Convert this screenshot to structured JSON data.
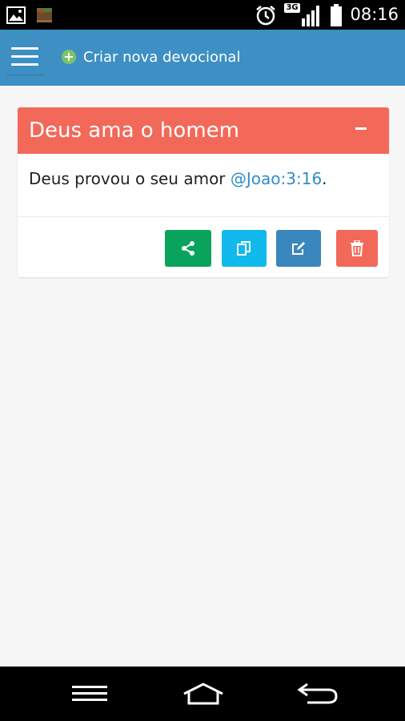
{
  "status_bar": {
    "time": "08:16",
    "network": "3G",
    "icons": [
      "image-icon",
      "book-app-icon",
      "alarm-icon",
      "signal-icon",
      "battery-icon"
    ]
  },
  "app_bar": {
    "create_label": "Criar nova devocional",
    "color": "#3d8fc4"
  },
  "devotional": {
    "title": "Deus ama o homem",
    "text_prefix": "Deus provou o seu amor ",
    "reference": "@Joao:3:16",
    "text_suffix": ".",
    "header_color": "#f2695a",
    "actions": [
      {
        "icon": "share-icon",
        "color": "#0aa35e"
      },
      {
        "icon": "copy-icon",
        "color": "#12b9ec"
      },
      {
        "icon": "edit-icon",
        "color": "#3a87bd"
      },
      {
        "icon": "trash-icon",
        "color": "#f2695a"
      }
    ]
  },
  "nav_bar": {
    "icons": [
      "menu-icon",
      "home-icon",
      "back-icon"
    ]
  }
}
